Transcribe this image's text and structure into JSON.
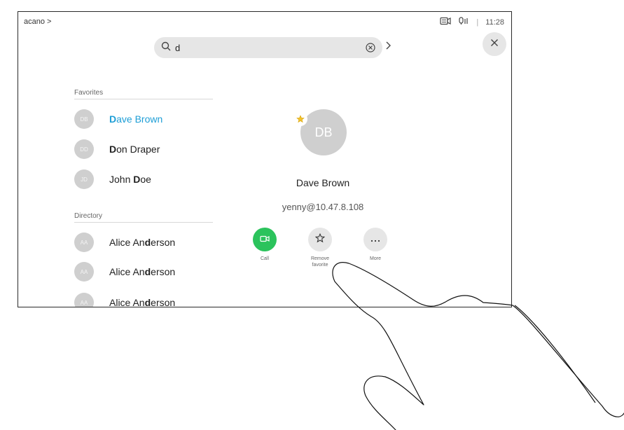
{
  "topbar": {
    "breadcrumb": "acano >",
    "time": "11:28",
    "separator": "|"
  },
  "search": {
    "query": "d"
  },
  "favorites": {
    "title": "Favorites",
    "items": [
      {
        "initials": "DB",
        "name_bold": "D",
        "name_rest": "ave Brown",
        "selected": true
      },
      {
        "initials": "DD",
        "name_bold": "D",
        "name_rest": "on Draper",
        "selected": false
      },
      {
        "initials": "JD",
        "name_pre": "John ",
        "name_bold": "D",
        "name_rest": "oe",
        "selected": false
      }
    ]
  },
  "directory": {
    "title": "Directory",
    "items": [
      {
        "initials": "AA",
        "name_pre": "Alice An",
        "name_bold": "d",
        "name_rest": "erson"
      },
      {
        "initials": "AA",
        "name_pre": "Alice An",
        "name_bold": "d",
        "name_rest": "erson"
      },
      {
        "initials": "AA",
        "name_pre": "Alice An",
        "name_bold": "d",
        "name_rest": "erson"
      }
    ]
  },
  "detail": {
    "initials": "DB",
    "name": "Dave Brown",
    "uri": "yenny@10.47.8.108",
    "actions": {
      "call": "Call",
      "remove_favorite": "Remove favorite",
      "more": "More"
    }
  },
  "colors": {
    "accent": "#1e9ed6",
    "call_green": "#2bc35c",
    "favorite_star": "#f2c12e",
    "avatar_gray": "#cfcfcf"
  },
  "icons": [
    "search-icon",
    "clear-search-icon",
    "chevron-right-icon",
    "close-icon",
    "camera-icon",
    "microphone-icon",
    "star-icon",
    "video-icon",
    "ellipsis-icon"
  ]
}
